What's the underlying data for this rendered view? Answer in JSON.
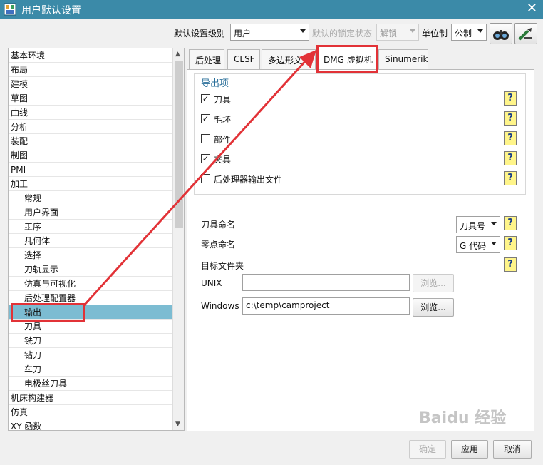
{
  "window": {
    "title": "用户默认设置",
    "close_glyph": "✕"
  },
  "toolbar": {
    "level_label": "默认设置级别",
    "level_value": "用户",
    "lock_label": "默认的锁定状态",
    "lock_value": "解锁",
    "unit_label": "单位制",
    "unit_value": "公制"
  },
  "tree": {
    "items": [
      {
        "label": "基本环境"
      },
      {
        "label": "布局"
      },
      {
        "label": "建模"
      },
      {
        "label": "草图"
      },
      {
        "label": "曲线"
      },
      {
        "label": "分析"
      },
      {
        "label": "装配"
      },
      {
        "label": "制图"
      },
      {
        "label": "PMI"
      },
      {
        "label": "加工"
      },
      {
        "label": "常规"
      },
      {
        "label": "用户界面"
      },
      {
        "label": "工序"
      },
      {
        "label": "几何体"
      },
      {
        "label": "选择"
      },
      {
        "label": "刀轨显示"
      },
      {
        "label": "仿真与可视化"
      },
      {
        "label": "后处理配置器"
      },
      {
        "label": "输出"
      },
      {
        "label": "刀具"
      },
      {
        "label": "铣刀"
      },
      {
        "label": "钻刀"
      },
      {
        "label": "车刀"
      },
      {
        "label": "电极丝刀具"
      },
      {
        "label": "机床构建器"
      },
      {
        "label": "仿真"
      },
      {
        "label": "XY 函数"
      }
    ]
  },
  "tabs": [
    {
      "label": "后处理"
    },
    {
      "label": "CLSF"
    },
    {
      "label": "多边形文件"
    },
    {
      "label": "DMG 虚拟机"
    },
    {
      "label": "Sinumerik"
    }
  ],
  "export_group": {
    "title": "导出项",
    "options": [
      {
        "label": "刀具",
        "checked": true,
        "mark": "✓"
      },
      {
        "label": "毛坯",
        "checked": true,
        "mark": "✓"
      },
      {
        "label": "部件",
        "checked": false,
        "mark": ""
      },
      {
        "label": "夹具",
        "checked": true,
        "mark": "✓"
      },
      {
        "label": "后处理器输出文件",
        "checked": false,
        "mark": ""
      }
    ]
  },
  "help_glyph": "?",
  "naming": {
    "tool_label": "刀具命名",
    "tool_value": "刀具号",
    "zero_label": "零点命名",
    "zero_value": "G 代码",
    "target_label": "目标文件夹",
    "unix_label": "UNIX",
    "unix_value": "",
    "browse_label": "浏览...",
    "windows_label": "Windows",
    "windows_value": "c:\\temp\\camproject"
  },
  "footer": {
    "ok": "确定",
    "apply": "应用",
    "cancel": "取消"
  },
  "watermark": "Baidu 经验",
  "colors": {
    "titlebar": "#3b8aa8",
    "selection": "#7cbcd2",
    "annotation": "#e23237",
    "group_title": "#2a6f9a"
  }
}
